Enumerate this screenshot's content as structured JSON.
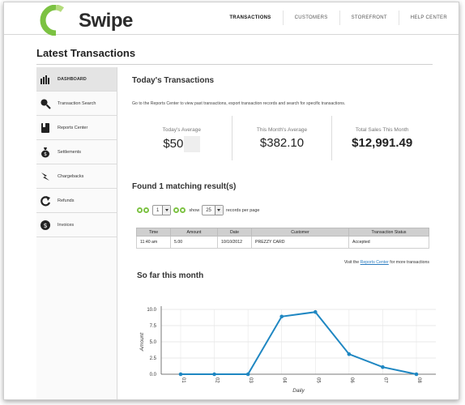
{
  "brand": {
    "name": "Swipe",
    "accent": "#7cc242"
  },
  "nav": [
    {
      "label": "TRANSACTIONS",
      "active": true
    },
    {
      "label": "CUSTOMERS",
      "active": false
    },
    {
      "label": "STOREFRONT",
      "active": false
    },
    {
      "label": "HELP CENTER",
      "active": false
    }
  ],
  "page": {
    "title": "Latest Transactions"
  },
  "sidebar": [
    {
      "label": "DASHBOARD",
      "icon": "bar-chart-icon",
      "active": true
    },
    {
      "label": "Transaction Search",
      "icon": "magnifier-icon",
      "active": false
    },
    {
      "label": "Reports Center",
      "icon": "book-icon",
      "active": false
    },
    {
      "label": "Settlements",
      "icon": "money-bag-icon",
      "active": false
    },
    {
      "label": "Chargebacks",
      "icon": "lightning-icon",
      "active": false
    },
    {
      "label": "Refunds",
      "icon": "refresh-arrow-icon",
      "active": false
    },
    {
      "label": "Invoices",
      "icon": "dollar-coin-icon",
      "active": false
    }
  ],
  "today": {
    "title": "Today's Transactions",
    "intro": "Go to the Reports Center to view past transactions, export transaction records and search for specific transactions.",
    "stats": [
      {
        "label": "Today's Average",
        "value": "$50"
      },
      {
        "label": "This Month's Average",
        "value": "$382.10"
      },
      {
        "label": "Total Sales This Month",
        "value": "$12,991.49"
      }
    ]
  },
  "results": {
    "title": "Found 1 matching result(s)",
    "page_value": "1",
    "show_label": "show",
    "per_page_value": "25",
    "per_page_label": "records per page",
    "columns": [
      "Time",
      "Amount",
      "Date",
      "Customer",
      "Transaction Status"
    ],
    "rows": [
      [
        "11:40 am",
        "5.00",
        "10/10/2012",
        "PREZZY CARD",
        "Accepted"
      ]
    ],
    "visit_prefix": "Visit the",
    "visit_link": "Reports Center",
    "visit_suffix": "for more transactions"
  },
  "month": {
    "title": "So far this month"
  },
  "chart_data": {
    "type": "line",
    "x": [
      "01",
      "02",
      "03",
      "04",
      "05",
      "06",
      "07",
      "08"
    ],
    "values": [
      0.0,
      0.0,
      0.0,
      8.9,
      9.6,
      3.1,
      1.1,
      0.0
    ],
    "xlabel": "Daily",
    "ylabel": "Amount",
    "ylim": [
      0,
      10
    ],
    "yticks": [
      "0.0",
      "2.5",
      "5.0",
      "7.5",
      "10.0"
    ],
    "line_color": "#1f87c2",
    "grid": true
  }
}
